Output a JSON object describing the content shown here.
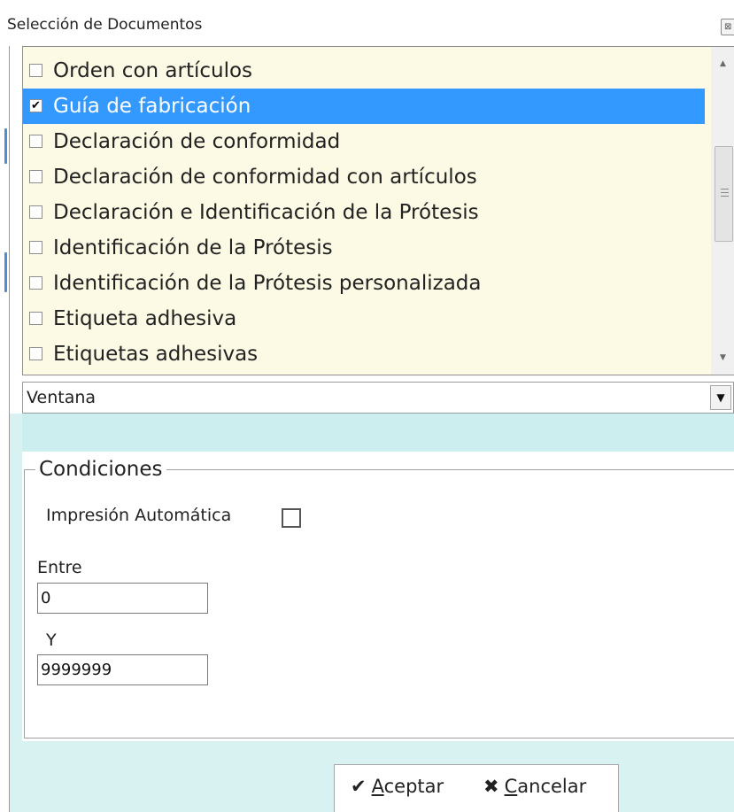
{
  "window": {
    "title": "Selección de Documentos",
    "close_glyph": "⊠"
  },
  "document_list": {
    "items": [
      {
        "label": "Orden con artículos",
        "checked": false,
        "selected": false
      },
      {
        "label": "Guía de fabricación",
        "checked": true,
        "selected": true
      },
      {
        "label": "Declaración de conformidad",
        "checked": false,
        "selected": false
      },
      {
        "label": "Declaración de conformidad con artículos",
        "checked": false,
        "selected": false
      },
      {
        "label": "Declaración e Identificación de la Prótesis",
        "checked": false,
        "selected": false
      },
      {
        "label": "Identificación de la Prótesis",
        "checked": false,
        "selected": false
      },
      {
        "label": "Identificación de la Prótesis personalizada",
        "checked": false,
        "selected": false
      },
      {
        "label": "Etiqueta adhesiva",
        "checked": false,
        "selected": false
      },
      {
        "label": "Etiquetas adhesivas",
        "checked": false,
        "selected": false
      }
    ],
    "scroll_up_icon": "▲",
    "scroll_down_icon": "▼"
  },
  "output_select": {
    "value": "Ventana",
    "arrow_icon": "▼"
  },
  "conditions": {
    "title": "Condiciones",
    "auto_print_label": "Impresión Automática",
    "auto_print_checked": false,
    "from_label": "Entre",
    "from_value": "0",
    "to_label": "Y",
    "to_value": "9999999"
  },
  "buttons": {
    "accept_icon": "✔",
    "accept_accel": "A",
    "accept_rest": "ceptar",
    "cancel_icon": "✖",
    "cancel_accel": "C",
    "cancel_rest": "ancelar"
  },
  "colors": {
    "list_background": "#fcfae4",
    "selection": "#3399ff",
    "panel_tint": "#d8f2f2"
  }
}
